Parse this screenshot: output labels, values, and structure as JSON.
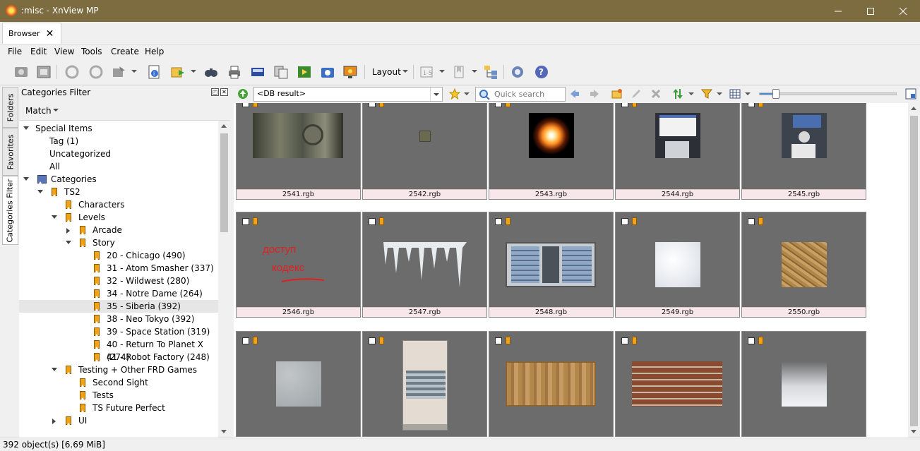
{
  "window": {
    "title": ":misc - XnView MP"
  },
  "tabs": [
    {
      "label": "Browser"
    }
  ],
  "menu": [
    "File",
    "Edit",
    "View",
    "Tools",
    "Create",
    "Help"
  ],
  "toolbar": {
    "layout_label": "Layout"
  },
  "side_tabs": [
    "Folders",
    "Favorites",
    "Categories Filter"
  ],
  "panel": {
    "title": "Categories Filter",
    "match_label": "Match",
    "tree": [
      {
        "label": "Special Items",
        "level": 0,
        "expand": "down",
        "icon": "none"
      },
      {
        "label": "Tag (1)",
        "level": 1,
        "expand": "none",
        "icon": "none"
      },
      {
        "label": "Uncategorized",
        "level": 1,
        "expand": "none",
        "icon": "none"
      },
      {
        "label": "All",
        "level": 1,
        "expand": "none",
        "icon": "none"
      },
      {
        "label": "Categories",
        "level": 0,
        "expand": "down",
        "icon": "book"
      },
      {
        "label": "TS2",
        "level": 1,
        "expand": "down",
        "icon": "tag"
      },
      {
        "label": "Characters",
        "level": 2,
        "expand": "none",
        "icon": "tag"
      },
      {
        "label": "Levels",
        "level": 2,
        "expand": "down",
        "icon": "tag"
      },
      {
        "label": "Arcade",
        "level": 3,
        "expand": "right",
        "icon": "tag"
      },
      {
        "label": "Story",
        "level": 3,
        "expand": "down",
        "icon": "tag"
      },
      {
        "label": "20 - Chicago (490)",
        "level": 4,
        "expand": "none",
        "icon": "tag"
      },
      {
        "label": "31 - Atom Smasher (337)",
        "level": 4,
        "expand": "none",
        "icon": "tag"
      },
      {
        "label": "32 - Wildwest (280)",
        "level": 4,
        "expand": "none",
        "icon": "tag"
      },
      {
        "label": "34 - Notre Dame (264)",
        "level": 4,
        "expand": "none",
        "icon": "tag"
      },
      {
        "label": "35 - Siberia (392)",
        "level": 4,
        "expand": "none",
        "icon": "tag",
        "selected": true
      },
      {
        "label": "38 - Neo Tokyo (392)",
        "level": 4,
        "expand": "none",
        "icon": "tag"
      },
      {
        "label": "39 - Space Station (319)",
        "level": 4,
        "expand": "none",
        "icon": "tag"
      },
      {
        "label": "40 - Return To Planet X (274)",
        "level": 4,
        "expand": "none",
        "icon": "tag"
      },
      {
        "label": "41 - Robot Factory (248)",
        "level": 4,
        "expand": "none",
        "icon": "tag"
      },
      {
        "label": "Testing + Other FRD Games",
        "level": 2,
        "expand": "down",
        "icon": "tag"
      },
      {
        "label": "Second Sight",
        "level": 3,
        "expand": "none",
        "icon": "tag"
      },
      {
        "label": "Tests",
        "level": 3,
        "expand": "none",
        "icon": "tag"
      },
      {
        "label": "TS Future Perfect",
        "level": 3,
        "expand": "none",
        "icon": "tag"
      },
      {
        "label": "UI",
        "level": 2,
        "expand": "right",
        "icon": "tag"
      }
    ]
  },
  "navbar": {
    "path": "<DB result>",
    "search_placeholder": "Quick search",
    "thumb_size": 0.12
  },
  "thumbnails": [
    {
      "name": "2541.rgb",
      "kind": "machine"
    },
    {
      "name": "2542.rgb",
      "kind": "tiny"
    },
    {
      "name": "2543.rgb",
      "kind": "flare"
    },
    {
      "name": "2544.rgb",
      "kind": "floppy-white"
    },
    {
      "name": "2545.rgb",
      "kind": "floppy-dark"
    },
    {
      "name": "2546.rgb",
      "kind": "handwriting",
      "overlay": [
        "доступ",
        "кодекс"
      ]
    },
    {
      "name": "2547.rgb",
      "kind": "icicles"
    },
    {
      "name": "2548.rgb",
      "kind": "window"
    },
    {
      "name": "2549.rgb",
      "kind": "snow"
    },
    {
      "name": "2550.rgb",
      "kind": "wood"
    },
    {
      "name": "",
      "kind": "concrete"
    },
    {
      "name": "",
      "kind": "building"
    },
    {
      "name": "",
      "kind": "rust-panel"
    },
    {
      "name": "",
      "kind": "brick"
    },
    {
      "name": "",
      "kind": "fog"
    }
  ],
  "status": {
    "text": "392 object(s) [6.69 MiB]"
  }
}
